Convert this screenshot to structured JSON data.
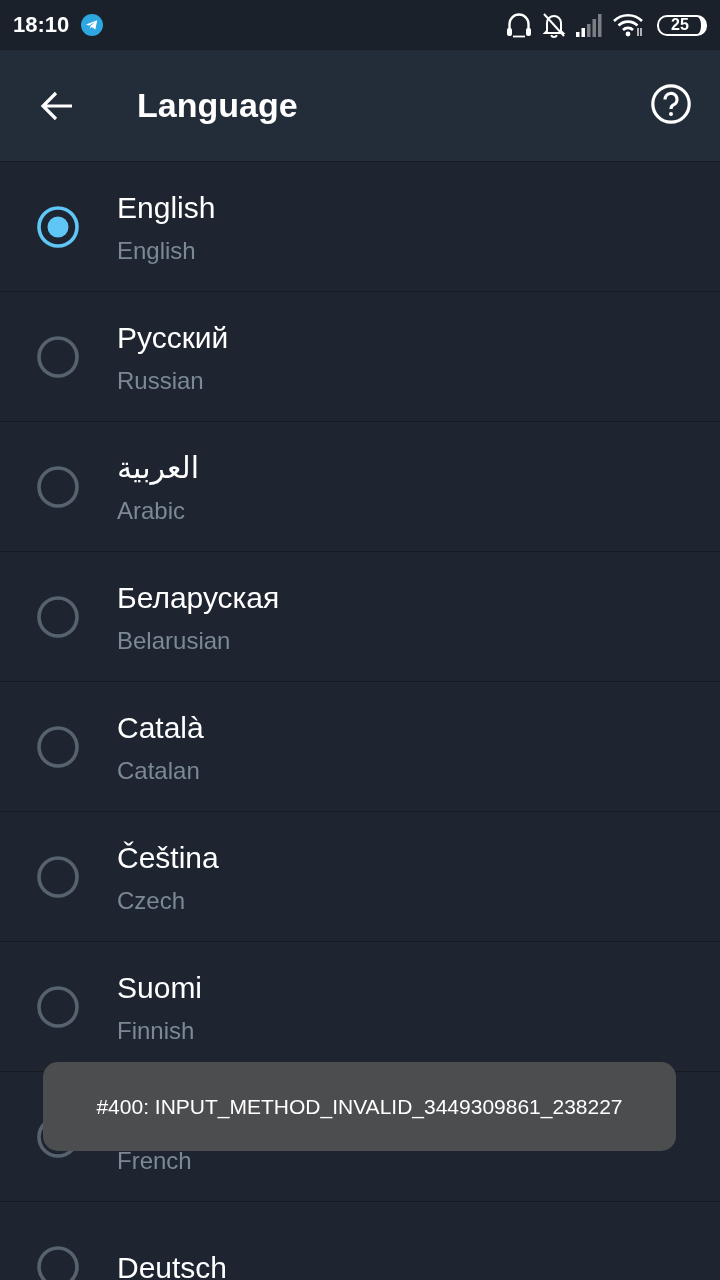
{
  "status_bar": {
    "time": "18:10",
    "battery": "25"
  },
  "header": {
    "title": "Language"
  },
  "languages": [
    {
      "name": "English",
      "english_name": "English",
      "selected": true
    },
    {
      "name": "Русский",
      "english_name": "Russian",
      "selected": false
    },
    {
      "name": "العربية",
      "english_name": "Arabic",
      "selected": false
    },
    {
      "name": "Беларуская",
      "english_name": "Belarusian",
      "selected": false
    },
    {
      "name": "Català",
      "english_name": "Catalan",
      "selected": false
    },
    {
      "name": "Čeština",
      "english_name": "Czech",
      "selected": false
    },
    {
      "name": "Suomi",
      "english_name": "Finnish",
      "selected": false
    },
    {
      "english_name": "French",
      "selected": false
    },
    {
      "name": "Deutsch",
      "selected": false
    }
  ],
  "toast": {
    "text": "#400: INPUT_METHOD_INVALID_3449309861_238227"
  }
}
